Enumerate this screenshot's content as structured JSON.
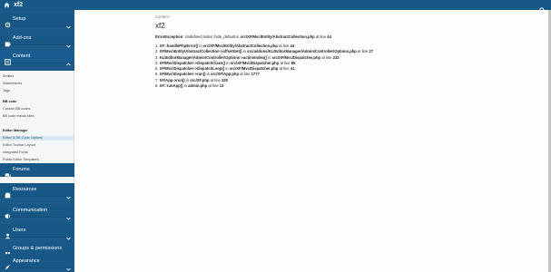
{
  "topbar": {
    "home_icon": "home-icon",
    "brand": "xf2",
    "search_icon": "search-icon"
  },
  "sidebar": {
    "sections": [
      {
        "label": "Setup",
        "icon": "gear-icon"
      },
      {
        "label": "Add-ons",
        "icon": "puzzle-icon"
      },
      {
        "label": "Content",
        "icon": "content-icon"
      },
      {
        "label": "Forums",
        "icon": "forums-icon"
      },
      {
        "label": "Resources",
        "icon": "resources-icon"
      },
      {
        "label": "Communication",
        "icon": "communication-icon"
      },
      {
        "label": "Users",
        "icon": "users-icon"
      },
      {
        "label": "Groups & permissions",
        "icon": "groups-icon"
      },
      {
        "label": "Appearance",
        "icon": "appearance-icon"
      }
    ],
    "content_submenu": [
      {
        "label": "Smilies",
        "kind": "item"
      },
      {
        "label": "Attachments",
        "kind": "item"
      },
      {
        "label": "Tags",
        "kind": "item"
      },
      {
        "label": "BB code",
        "kind": "heading"
      },
      {
        "label": "Custom BB codes",
        "kind": "item"
      },
      {
        "label": "BB code media sites",
        "kind": "item"
      },
      {
        "label": "Editor Manager",
        "kind": "heading"
      },
      {
        "label": "Editor & BB Code Options",
        "kind": "selected"
      },
      {
        "label": "Editor Toolbar Layout",
        "kind": "item"
      },
      {
        "label": "Integrated Fonts",
        "kind": "item"
      },
      {
        "label": "Public Editor Templates",
        "kind": "item"
      }
    ]
  },
  "main": {
    "breadcrumb": "Content ›",
    "title": "xf2",
    "error": {
      "prefix": "ErrorException",
      "message": ": Undefined index: hide_default in ",
      "file": "src/XF/Mvc/Entity/AbstractCollection.php",
      "at_line": " at line ",
      "line": "44"
    },
    "trace": [
      {
        "num": "1.",
        "fn": "XF::handlePhpError()",
        "file": "src/XF/Mvc/Entity/AbstractCollection.php",
        "line": "44"
      },
      {
        "num": "2.",
        "fn": "XF\\Mvc\\Entity\\AbstractCollection->offsetGet()",
        "file": "src/addons/KL/EditorManager/Admin/Controller/Options.php",
        "line": "27"
      },
      {
        "num": "3.",
        "fn": "KL\\EditorManager\\Admin\\Controller\\Options->actionIndex()",
        "file": "src/XF/Mvc/Dispatcher.php",
        "line": "232"
      },
      {
        "num": "4.",
        "fn": "XF\\Mvc\\Dispatcher->dispatchClass()",
        "file": "src/XF/Mvc/Dispatcher.php",
        "line": "85"
      },
      {
        "num": "5.",
        "fn": "XF\\Mvc\\Dispatcher->dispatchLoop()",
        "file": "src/XF/Mvc/Dispatcher.php",
        "line": "41"
      },
      {
        "num": "6.",
        "fn": "XF\\Mvc\\Dispatcher->run()",
        "file": "src/XF/App.php",
        "line": "1777"
      },
      {
        "num": "7.",
        "fn": "XF\\App->run()",
        "file": "src/XF.php",
        "line": "320"
      },
      {
        "num": "8.",
        "fn": "XF::runApp()",
        "file": "admin.php",
        "line": "13"
      }
    ],
    "in_word": " in ",
    "at_line_word": " at line "
  },
  "colors": {
    "header_blue": "#185886",
    "sidebar_blue": "#1c5a8a",
    "submenu_bg": "#f5f6f7",
    "selected_bg": "#dbe7f1"
  }
}
